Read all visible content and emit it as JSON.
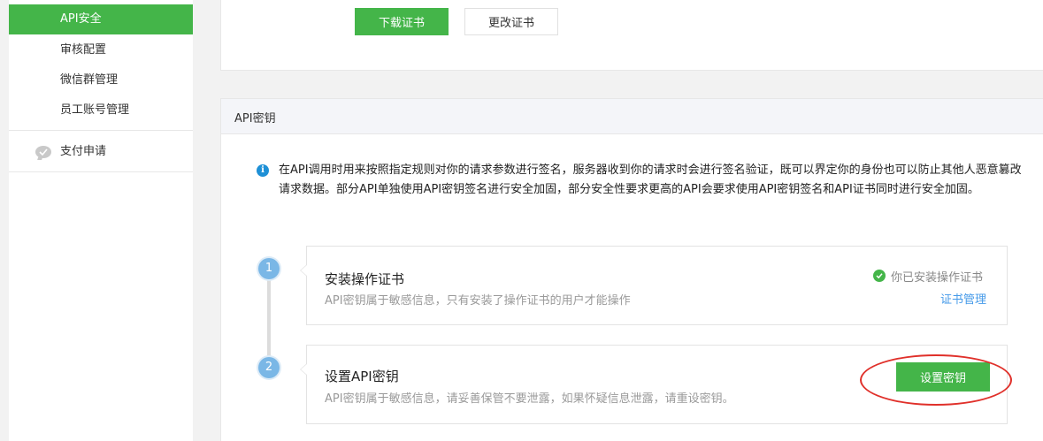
{
  "sidebar": {
    "items": [
      {
        "label": "API安全",
        "active": true
      },
      {
        "label": "审核配置",
        "active": false
      },
      {
        "label": "微信群管理",
        "active": false
      },
      {
        "label": "员工账号管理",
        "active": false
      }
    ],
    "pay": {
      "label": "支付申请",
      "icon": "chat-bubble-icon"
    }
  },
  "cert": {
    "download_label": "下载证书",
    "change_label": "更改证书"
  },
  "api_key": {
    "section_title": "API密钥",
    "description": "在API调用时用来按照指定规则对你的请求参数进行签名，服务器收到你的请求时会进行签名验证，既可以界定你的身份也可以防止其他人恶意篡改请求数据。部分API单独使用API密钥签名进行安全加固，部分安全性要求更高的API会要求使用API密钥签名和API证书同时进行安全加固。",
    "steps": [
      {
        "number": "1",
        "title": "安装操作证书",
        "subtitle": "API密钥属于敏感信息，只有安装了操作证书的用户才能操作",
        "status": "你已安装操作证书",
        "link": "证书管理"
      },
      {
        "number": "2",
        "title": "设置API密钥",
        "subtitle": "API密钥属于敏感信息，请妥善保管不要泄露，如果怀疑信息泄露，请重设密钥。",
        "button": "设置密钥"
      }
    ]
  },
  "colors": {
    "brand_green": "#44b549",
    "link_blue": "#459ae9",
    "annotation_red": "#e0302a"
  }
}
